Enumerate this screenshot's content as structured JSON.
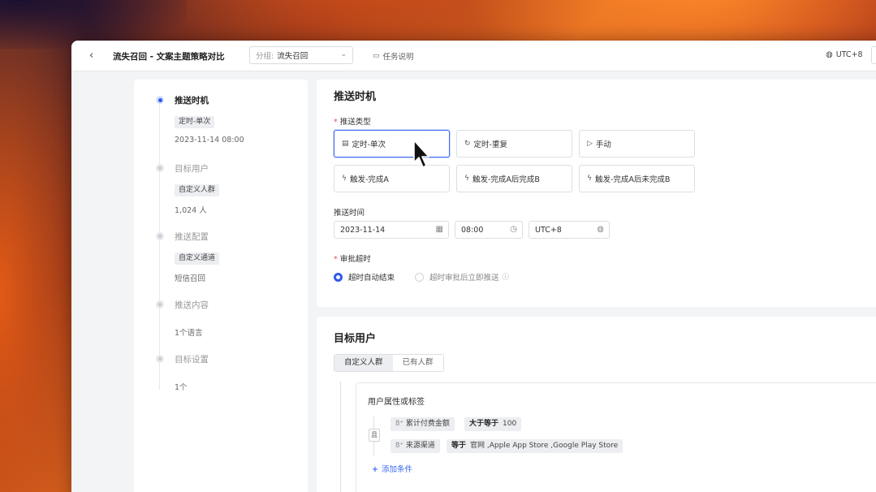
{
  "topbar": {
    "back_icon": "chevron-left-icon",
    "title": "流失召回 - 文案主题策略对比",
    "group_label": "分组:",
    "group_value": "流失召回",
    "task_desc": "任务说明",
    "timezone": "UTC+8"
  },
  "steps": [
    {
      "title": "推送时机",
      "tag": "定时-单次",
      "sub": "2023-11-14 08:00"
    },
    {
      "title": "目标用户",
      "tag": "自定义人群",
      "sub": "1,024 人"
    },
    {
      "title": "推送配置",
      "tag": "自定义通道",
      "sub": "短信召回"
    },
    {
      "title": "推送内容",
      "sub": "1个语言"
    },
    {
      "title": "目标设置",
      "sub": "1个"
    }
  ],
  "push_timing": {
    "title": "推送时机",
    "type_label": "推送类型",
    "options": [
      {
        "label": "定时-单次",
        "icon": "calendar-icon"
      },
      {
        "label": "定时-重复",
        "icon": "repeat-icon"
      },
      {
        "label": "手动",
        "icon": "cursor-icon"
      },
      {
        "label": "触发-完成A",
        "icon": "bolt-icon"
      },
      {
        "label": "触发-完成A后完成B",
        "icon": "bolt-icon"
      },
      {
        "label": "触发-完成A后未完成B",
        "icon": "bolt-icon"
      }
    ],
    "time_label": "推送时间",
    "date": "2023-11-14",
    "time": "08:00",
    "tz": "UTC+8",
    "approval_label": "审批超时",
    "radio_auto_end": "超时自动结束",
    "radio_push_after": "超时审批后立即推送"
  },
  "target_users": {
    "title": "目标用户",
    "seg_custom": "自定义人群",
    "seg_existing": "已有人群",
    "cond_title": "用户属性或标签",
    "and_label": "且",
    "cond1_field": "累计付费金额",
    "cond1_op": "大于等于",
    "cond1_value": "100",
    "cond2_field": "来源渠道",
    "cond2_op": "等于",
    "cond2_value": "官网 ,Apple App Store ,Google Play Store",
    "add_condition": "添加条件"
  },
  "colors": {
    "accent": "#2f5bea",
    "required": "#e34d4d"
  }
}
